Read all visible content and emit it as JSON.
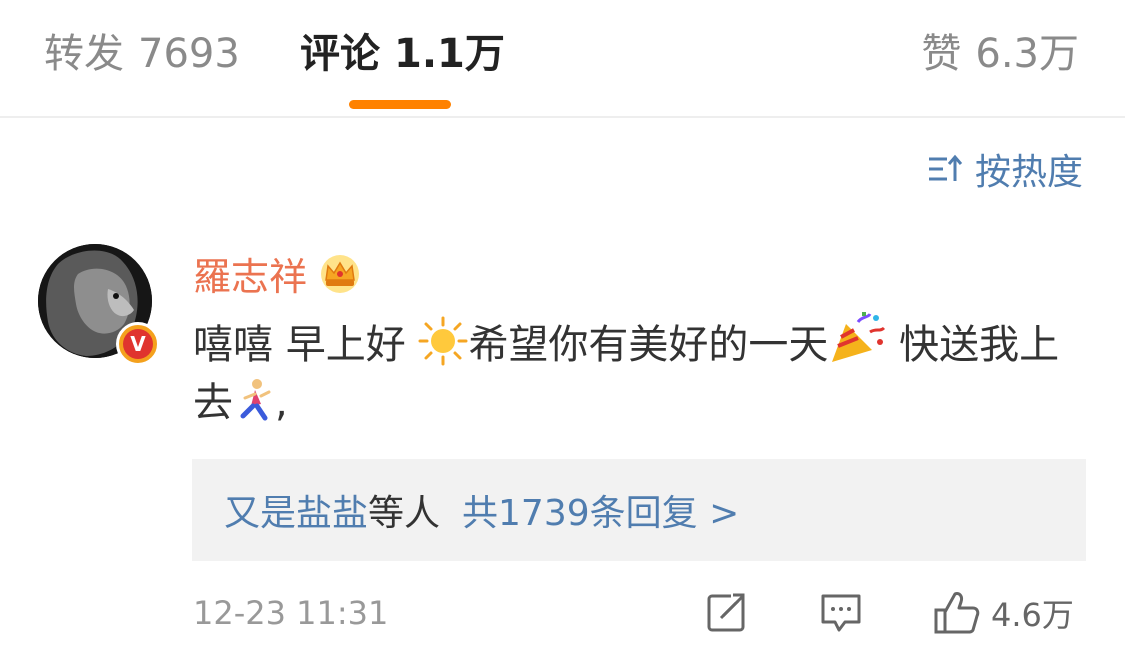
{
  "tabs": {
    "repost_label": "转发",
    "repost_count": "7693",
    "comment_label": "评论",
    "comment_count": "1.1万",
    "like_label": "赞",
    "like_count": "6.3万",
    "active": "comment"
  },
  "sort": {
    "label": "按热度",
    "icon": "sort-icon"
  },
  "comment": {
    "username": "羅志祥",
    "badge_icon": "crown-icon",
    "verified_icon": "verified-v-icon",
    "text_parts": [
      "嘻嘻 早上好 ",
      "希望你有美好的一天",
      " 快送我上去",
      ","
    ],
    "emojis": [
      "sun-emoji",
      "party-popper-emoji",
      "runner-emoji"
    ],
    "replies": {
      "user": "又是盐盐",
      "suffix": "等人",
      "total": "共1739条回复 >"
    },
    "time": "12-23 11:31",
    "likes": "4.6万"
  },
  "colors": {
    "accent_orange": "#ff8200",
    "link_blue": "#507daf",
    "username_orange": "#eb7350",
    "text": "#333333",
    "muted": "#999999",
    "reply_bg": "#f2f2f2"
  }
}
